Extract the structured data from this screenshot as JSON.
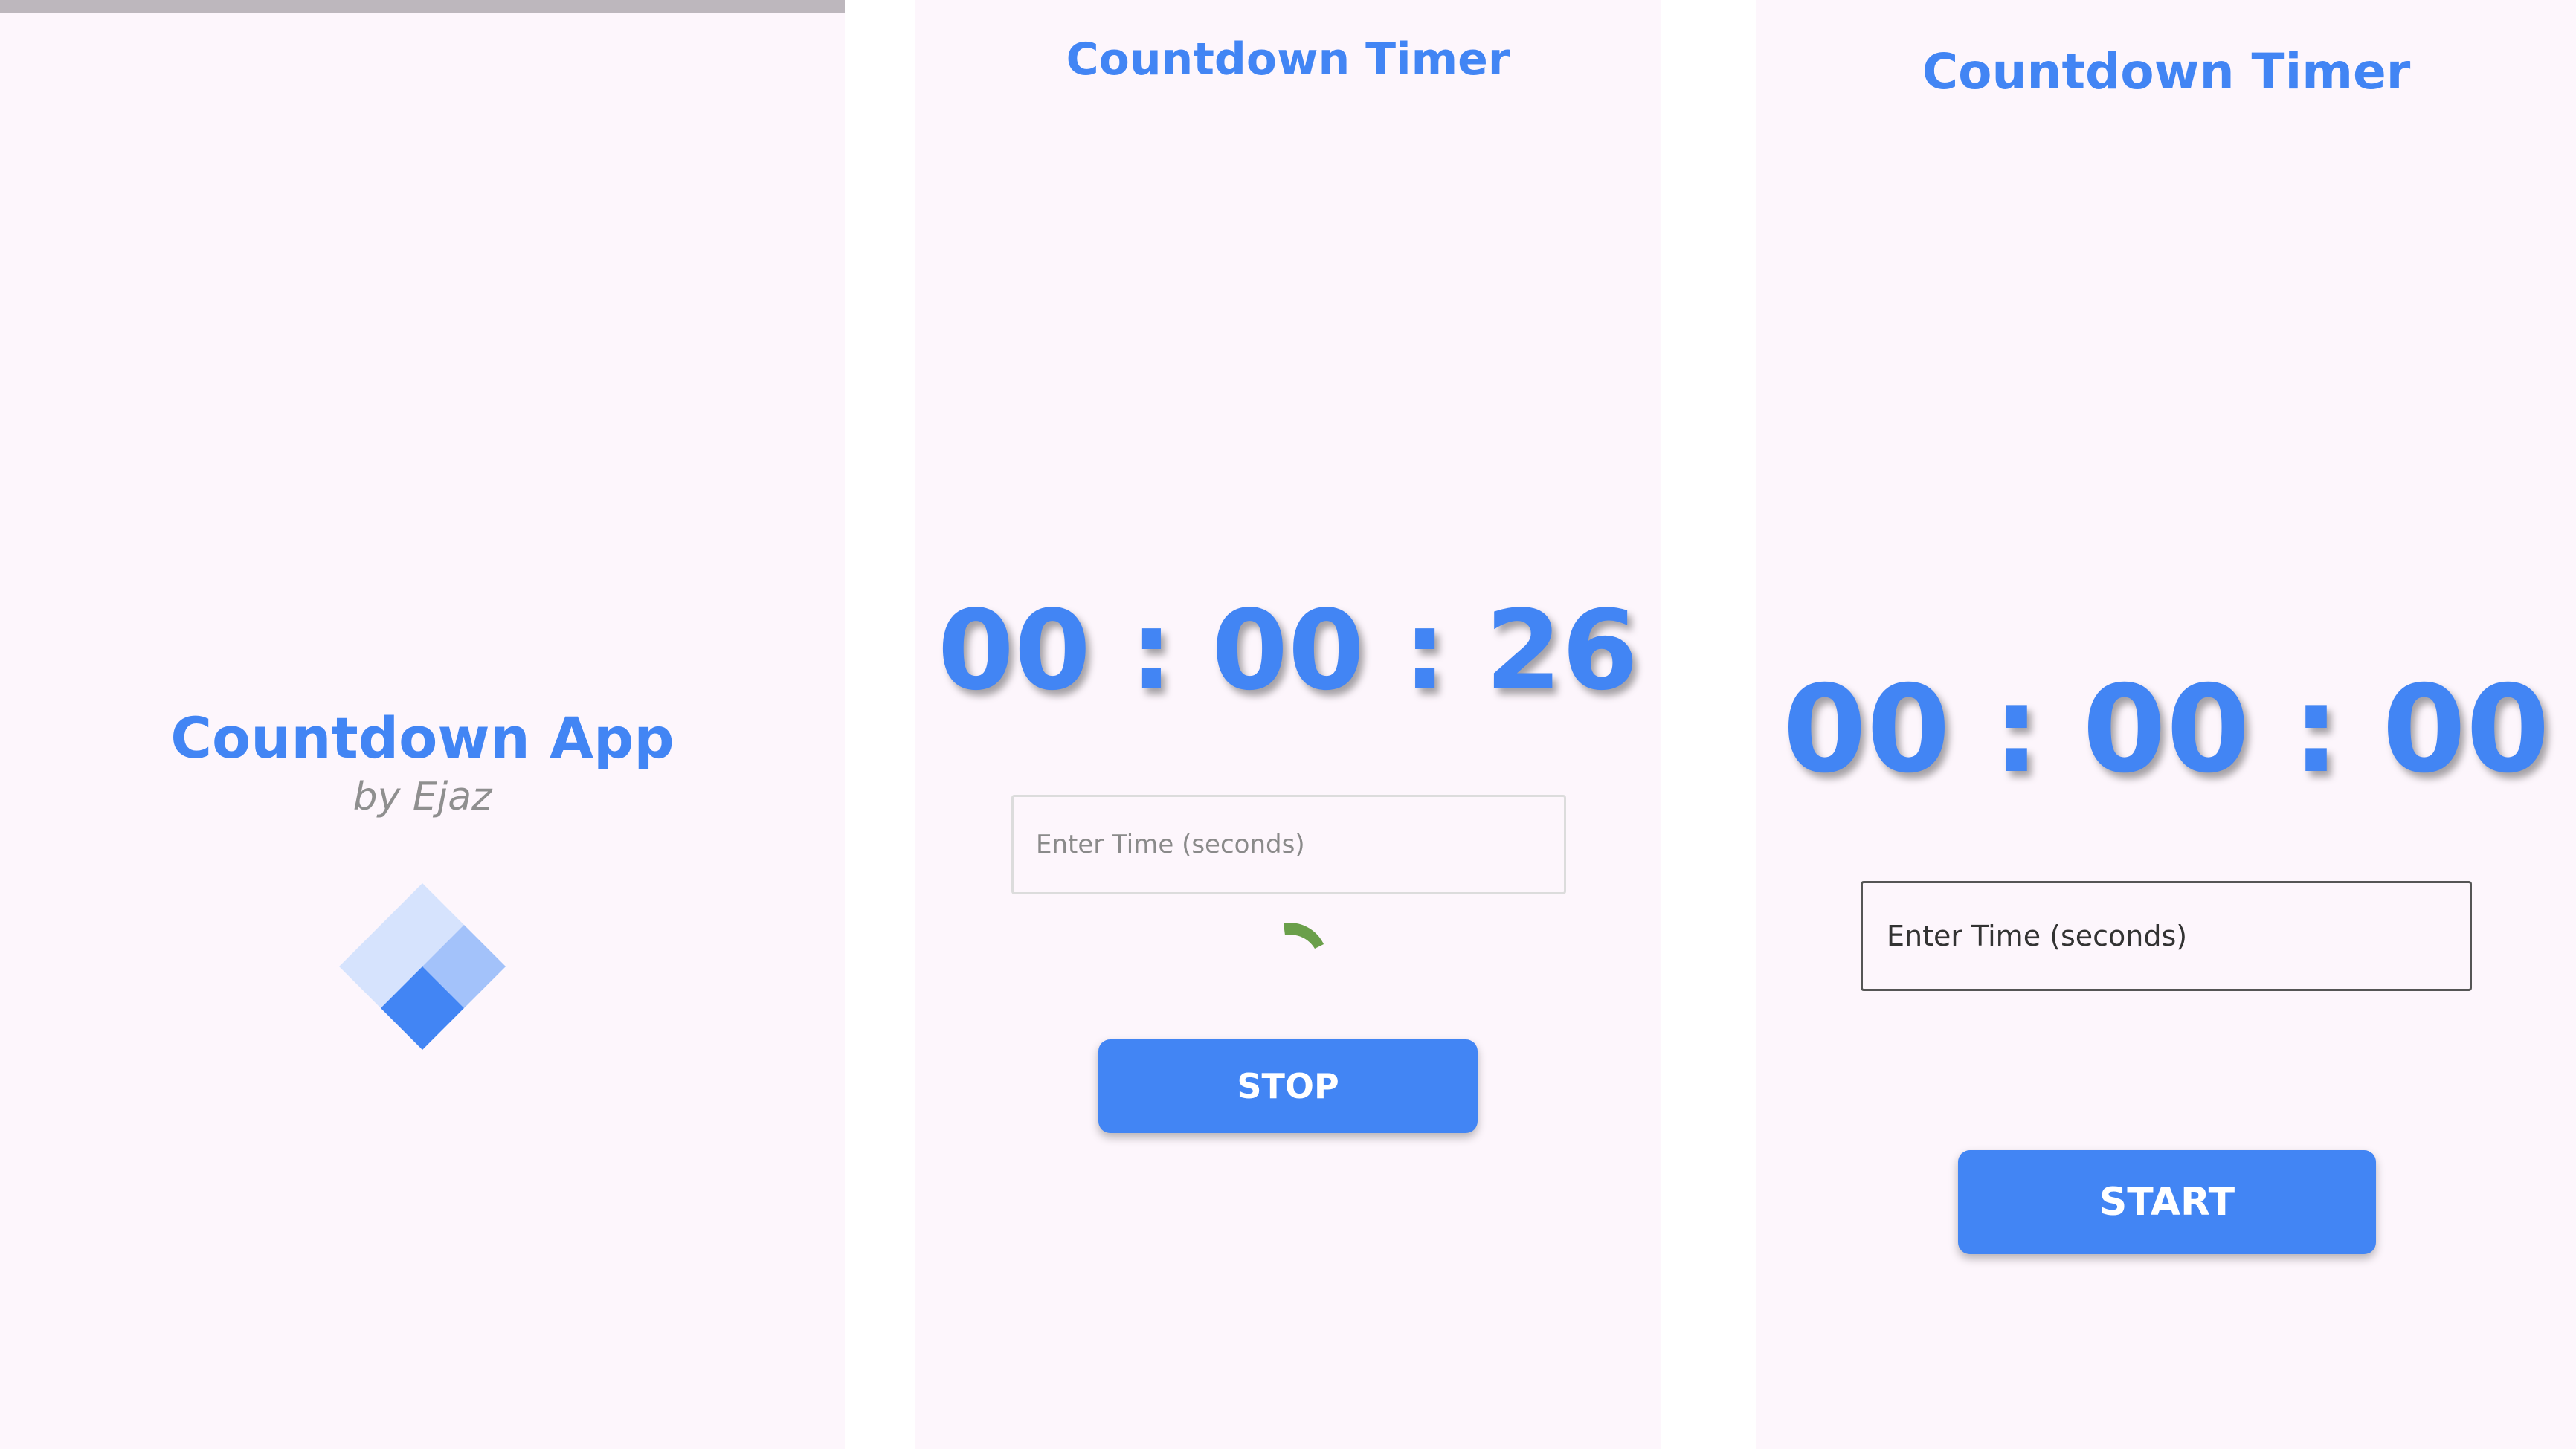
{
  "splash": {
    "title": "Countdown App",
    "subtitle": "by Ejaz",
    "logo_icon": "layered-diamond-logo-icon"
  },
  "running_screen": {
    "title": "Countdown Timer",
    "timer": "00 : 00 : 26",
    "input": {
      "value": "",
      "placeholder": "Enter Time (seconds)"
    },
    "spinner_icon": "loading-spinner-icon",
    "button_label": "STOP"
  },
  "idle_screen": {
    "title": "Countdown Timer",
    "timer": "00 : 00 : 00",
    "input": {
      "value": "",
      "placeholder": "Enter Time (seconds)"
    },
    "button_label": "START"
  },
  "colors": {
    "accent": "#4285f4",
    "background": "#fdf6fc",
    "spinner": "#6a9f4a"
  }
}
